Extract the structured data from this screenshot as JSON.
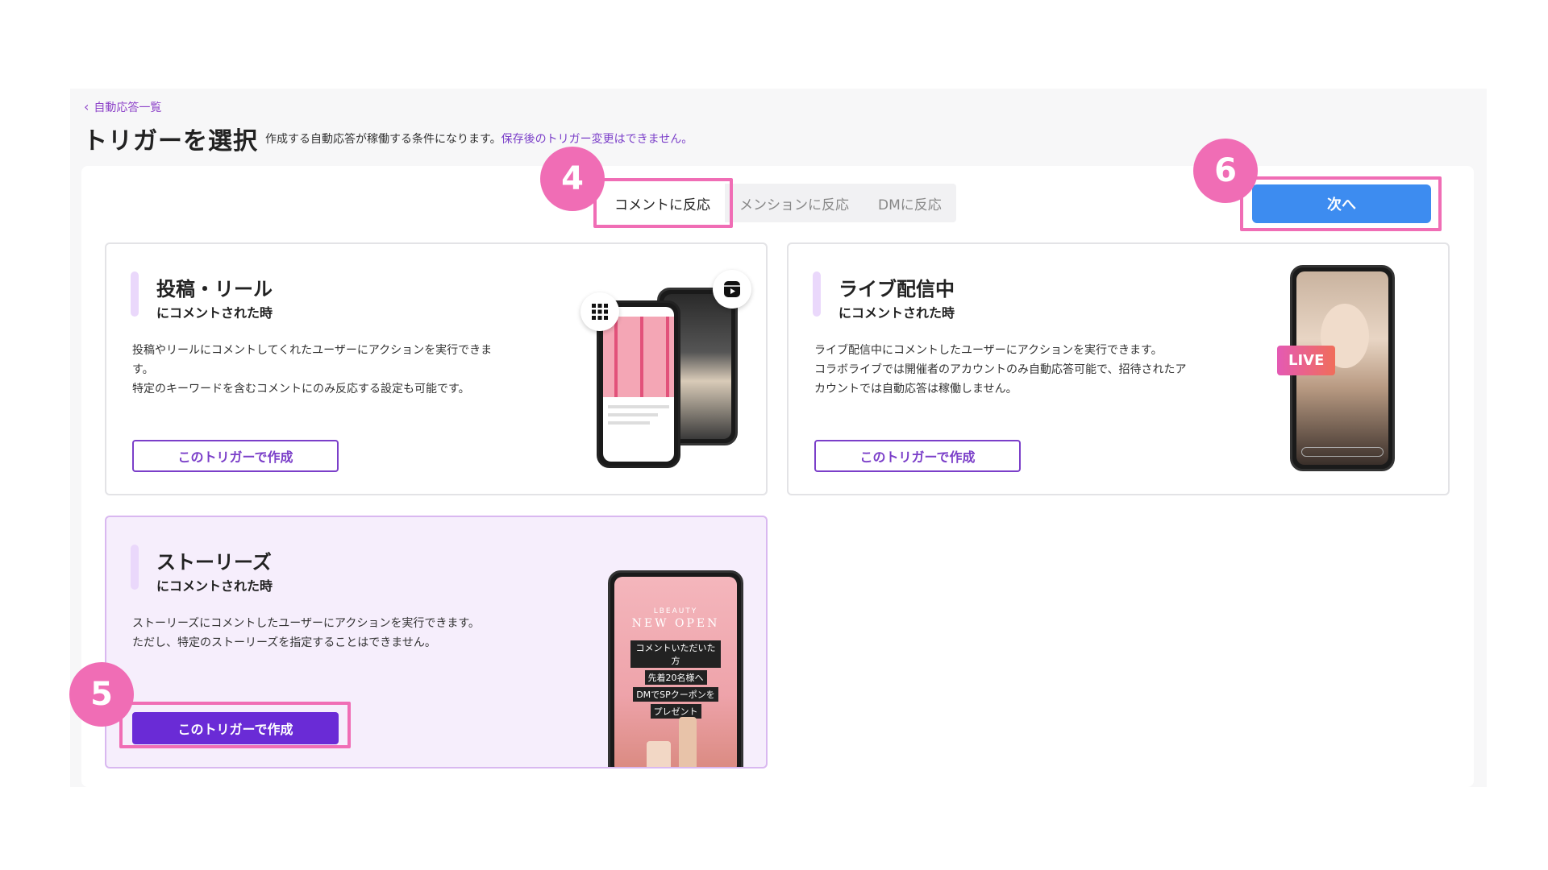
{
  "back_link": "自動応答一覧",
  "page_title": "トリガーを選択",
  "description": {
    "text": "作成する自動応答が稼働する条件になります。",
    "warning": "保存後のトリガー変更はできません。"
  },
  "tabs": [
    {
      "label": "コメントに反応",
      "active": true
    },
    {
      "label": "メンションに反応",
      "active": false
    },
    {
      "label": "DMに反応",
      "active": false
    }
  ],
  "next_button": "次へ",
  "cards": [
    {
      "title": "投稿・リール",
      "subtitle": "にコメントされた時",
      "description_lines": [
        "投稿やリールにコメントしてくれたユーザーにアクションを実行できま",
        "す。",
        "特定のキーワードを含むコメントにのみ反応する設定も可能です。"
      ],
      "button": "このトリガーで作成"
    },
    {
      "title": "ライブ配信中",
      "subtitle": "にコメントされた時",
      "description_lines": [
        "ライブ配信中にコメントしたユーザーにアクションを実行できます。",
        "コラボライブでは開催者のアカウントのみ自動応答可能で、招待されたア",
        "カウントでは自動応答は稼働しません。"
      ],
      "button": "このトリガーで作成",
      "live_label": "LIVE"
    },
    {
      "title": "ストーリーズ",
      "subtitle": "にコメントされた時",
      "description_lines": [
        "ストーリーズにコメントしたユーザーにアクションを実行できます。",
        "ただし、特定のストーリーズを指定することはできません。"
      ],
      "button": "このトリガーで作成",
      "selected": true,
      "story": {
        "brand": "LBEAUTY",
        "headline": "NEW OPEN",
        "lines": [
          "コメントいただいた方",
          "先着20名様へ",
          "DMでSPクーポンを",
          "プレゼント"
        ]
      }
    }
  ],
  "step_badges": [
    "4",
    "5",
    "6"
  ],
  "colors": {
    "accent_purple": "#7b3fc9",
    "highlight_pink": "#f06db5",
    "next_blue": "#3d8cf0"
  }
}
